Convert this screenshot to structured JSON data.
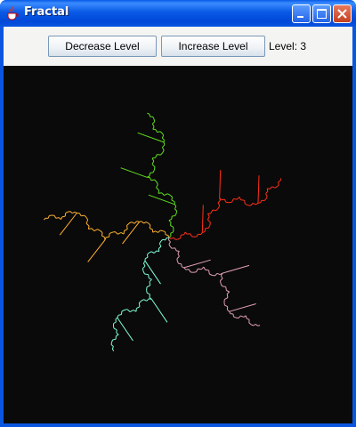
{
  "window": {
    "title": "Fractal",
    "frame_color": "#0a56e0"
  },
  "toolbar": {
    "decrease_label": "Decrease Level",
    "increase_label": "Increase Level",
    "level_text": "Level: 3"
  },
  "fractal": {
    "level": 3,
    "background": "#0a0a0a",
    "arm_colors": [
      "#ff3018",
      "#e2a0b8",
      "#80ffd8",
      "#ffb030",
      "#60e020"
    ]
  },
  "icons": {
    "app": "java-cup-icon",
    "minimize": "minimize-icon",
    "maximize": "maximize-icon",
    "close": "close-icon"
  }
}
